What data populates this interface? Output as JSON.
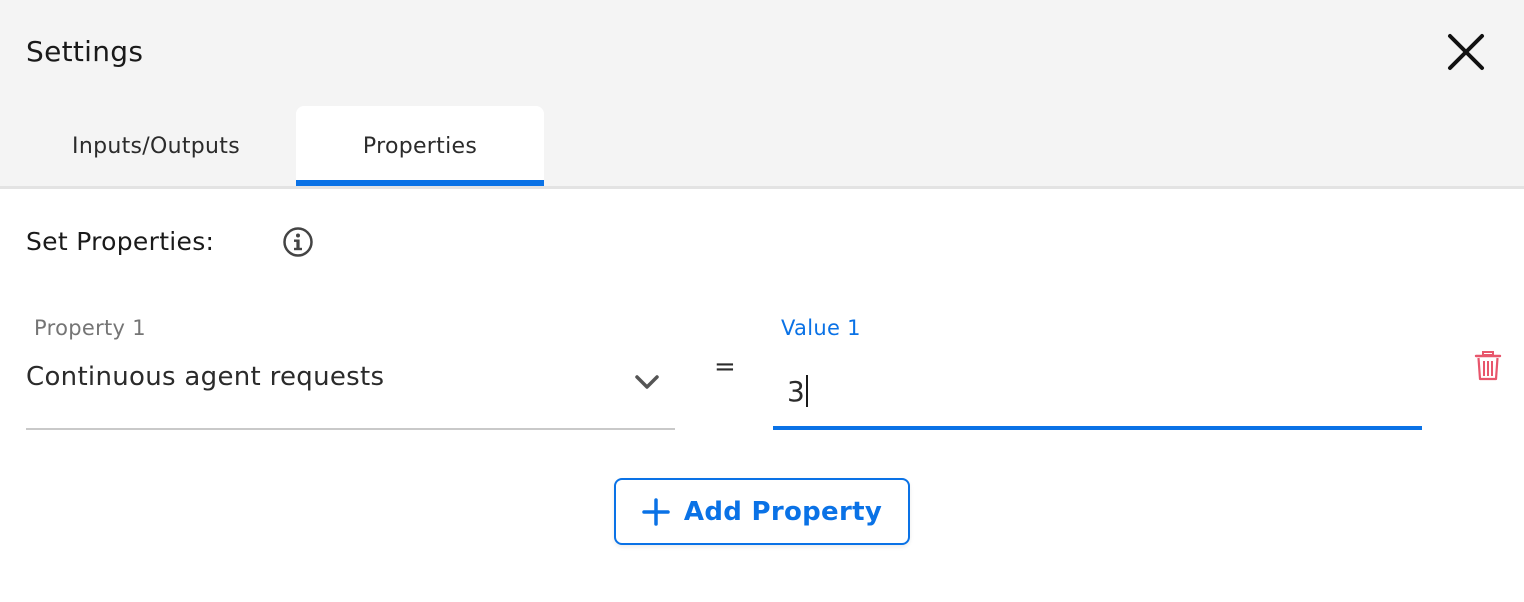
{
  "header": {
    "title": "Settings"
  },
  "tabs": [
    {
      "label": "Inputs/Outputs",
      "active": false
    },
    {
      "label": "Properties",
      "active": true
    }
  ],
  "section": {
    "label": "Set Properties:",
    "info_icon": "info-icon"
  },
  "property_row": {
    "property_label": "Property 1",
    "property_value": "Continuous agent requests",
    "equals": "=",
    "value_label": "Value 1",
    "value": "3"
  },
  "add_button": {
    "label": "Add Property",
    "icon": "plus-icon"
  },
  "icons": {
    "close": "close-icon",
    "chevron": "chevron-down-icon",
    "trash": "trash-icon"
  },
  "colors": {
    "accent": "#0a72e6",
    "delete": "#e8566c",
    "header_bg": "#f4f4f4",
    "label_gray": "#757575"
  }
}
